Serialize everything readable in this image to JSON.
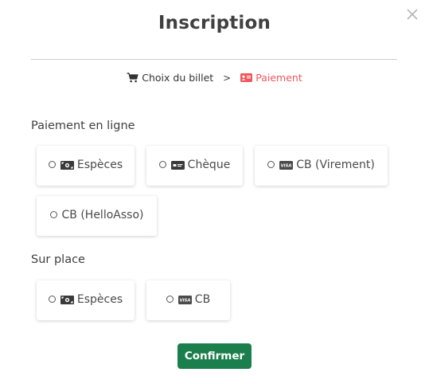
{
  "modal": {
    "title": "Inscription",
    "close_icon": "close-icon"
  },
  "steps": {
    "step1_label": "Choix du billet",
    "step1_icon": "cart-icon",
    "separator": ">",
    "step2_label": "Paiement",
    "step2_icon": "id-card-icon",
    "active_color": "#f0565c"
  },
  "online": {
    "label": "Paiement en ligne",
    "options": [
      {
        "label": "Espèces",
        "icon": "cash-icon"
      },
      {
        "label": "Chèque",
        "icon": "cheque-icon"
      },
      {
        "label": "CB (Virement)",
        "icon": "visa-card-icon"
      },
      {
        "label": "CB (HelloAsso)",
        "icon": ""
      }
    ]
  },
  "onsite": {
    "label": "Sur place",
    "options": [
      {
        "label": "Espèces",
        "icon": "cash-icon"
      },
      {
        "label": "CB",
        "icon": "visa-card-icon"
      }
    ]
  },
  "actions": {
    "confirm_label": "Confirmer",
    "confirm_color": "#1b7f4d"
  }
}
